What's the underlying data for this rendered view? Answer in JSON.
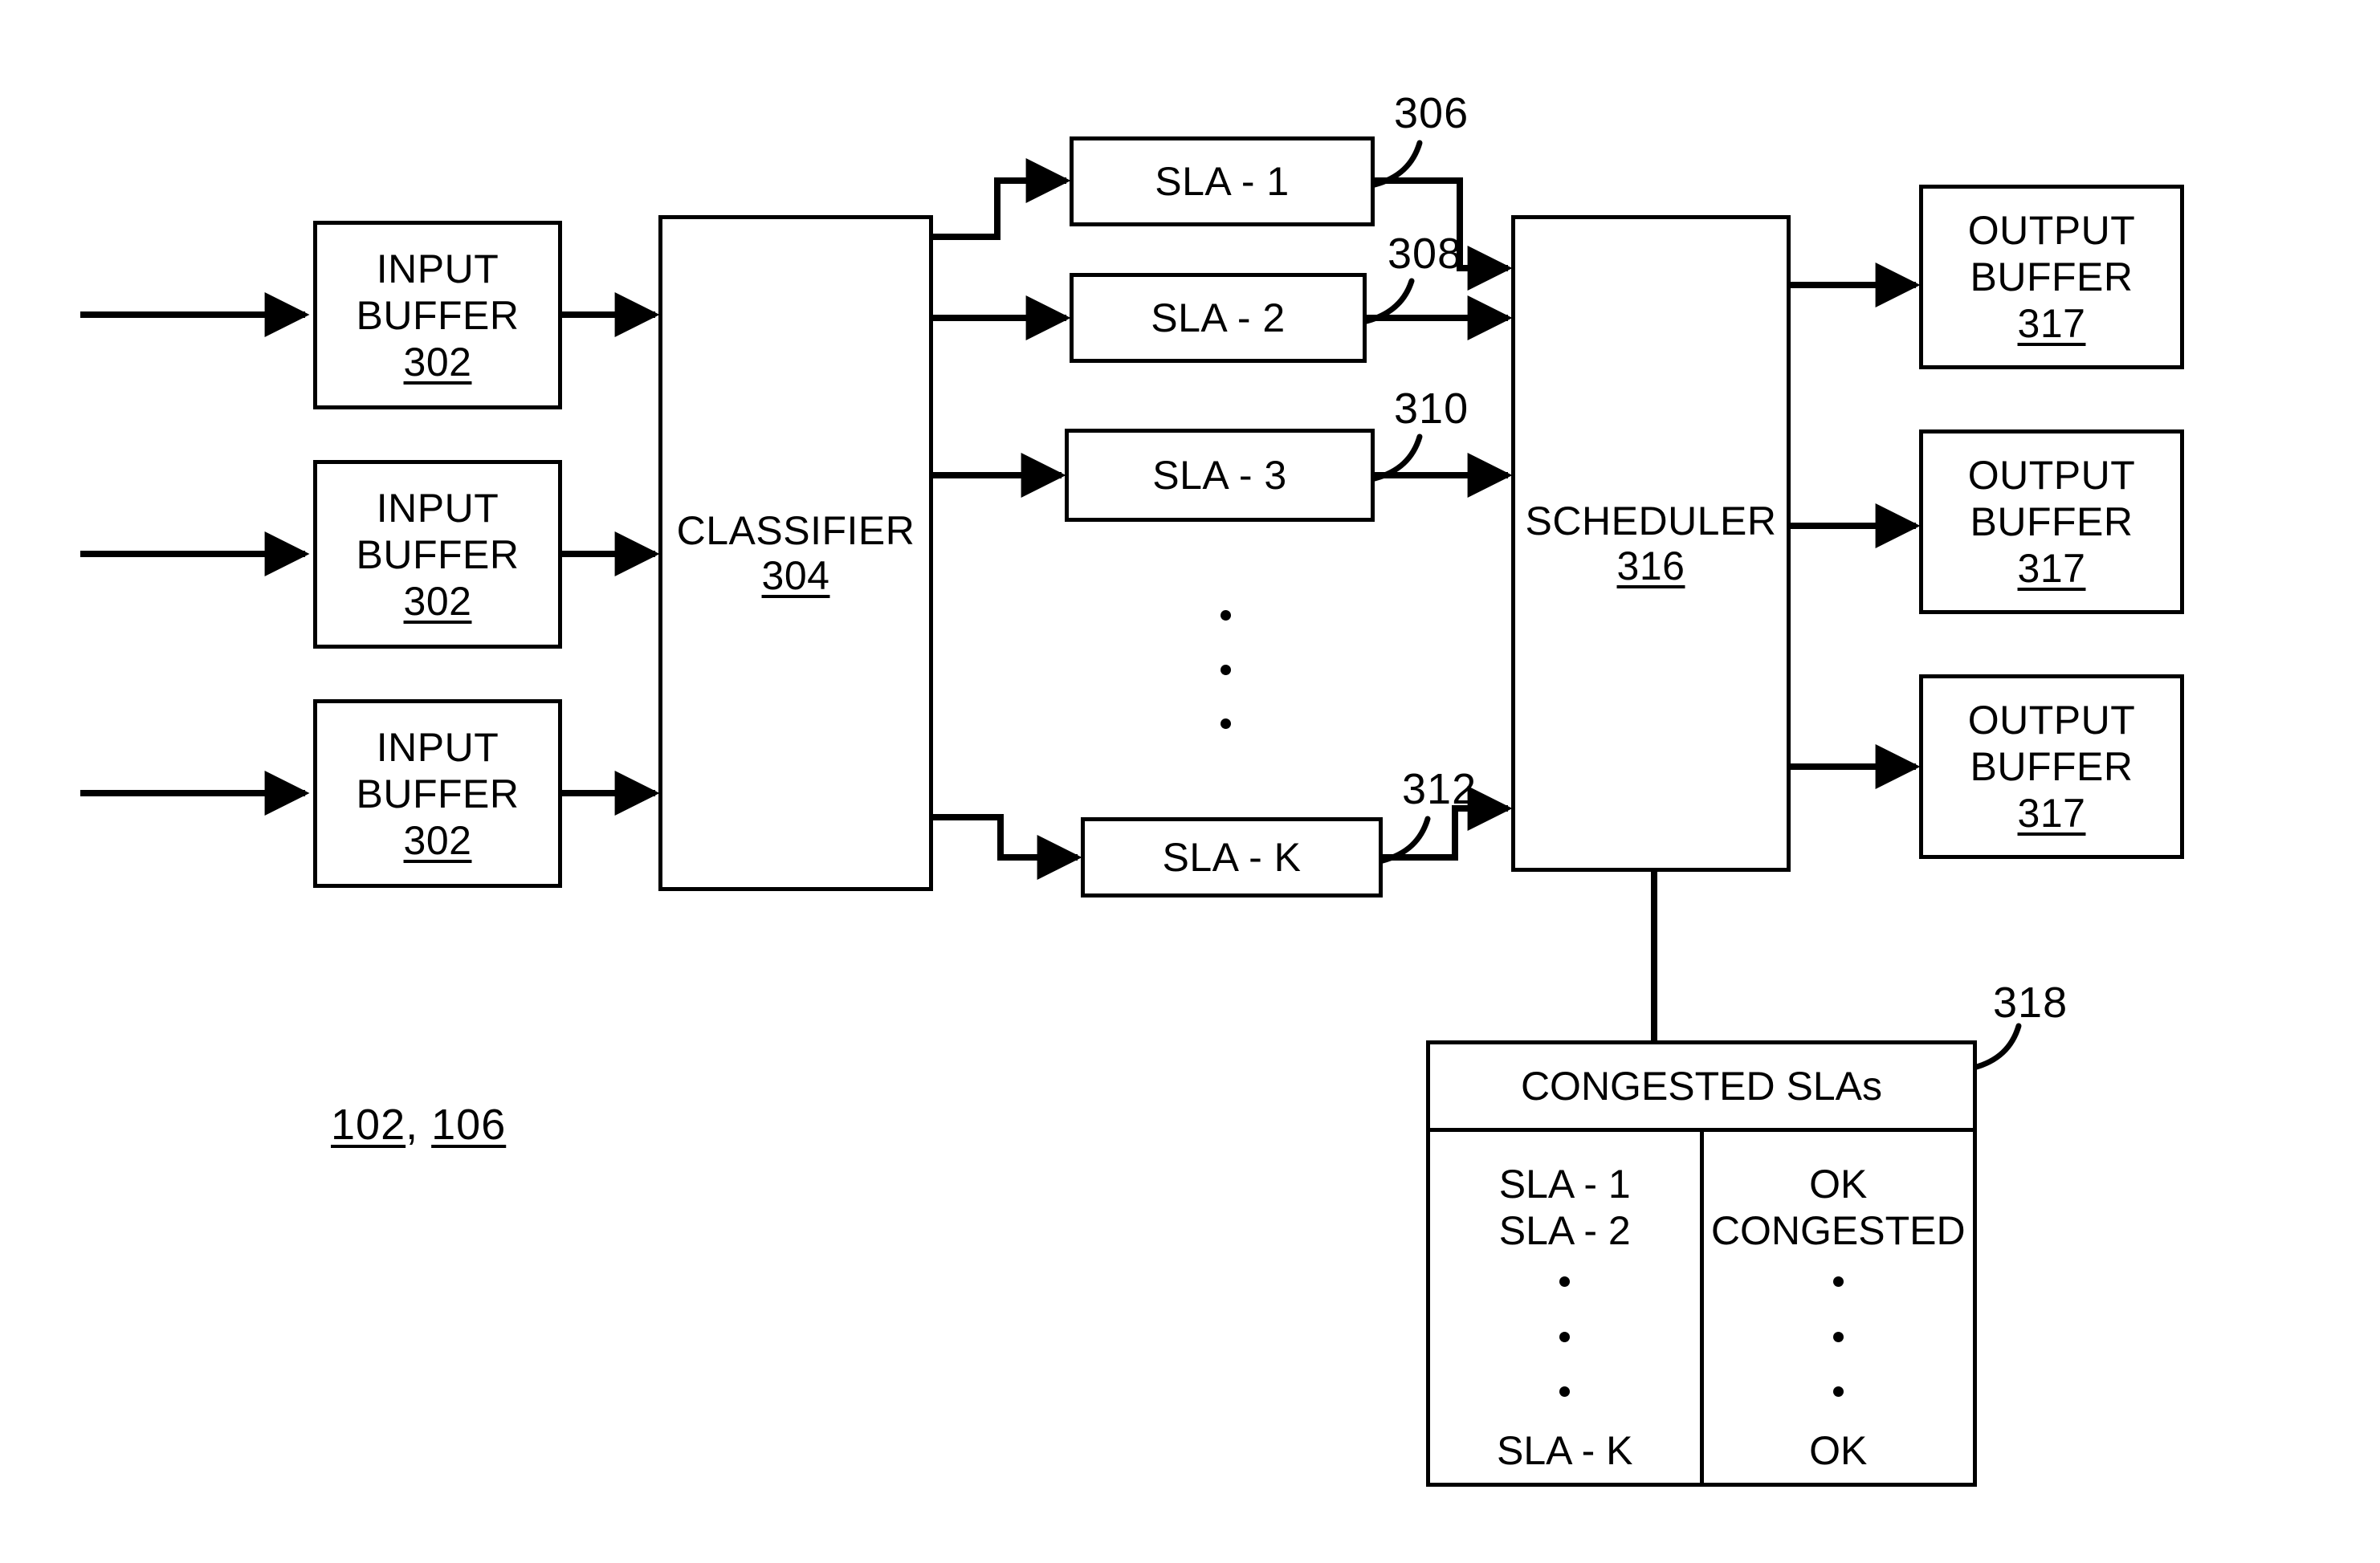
{
  "figure": {
    "system_tag_prefix": "102",
    "system_tag_sep": ", ",
    "system_tag_suffix": "106"
  },
  "input_buffers": [
    {
      "line1": "INPUT",
      "line2": "BUFFER",
      "ref": "302"
    },
    {
      "line1": "INPUT",
      "line2": "BUFFER",
      "ref": "302"
    },
    {
      "line1": "INPUT",
      "line2": "BUFFER",
      "ref": "302"
    }
  ],
  "classifier": {
    "label": "CLASSIFIER",
    "ref": "304"
  },
  "sla_queues": [
    {
      "label": "SLA - 1",
      "ref": "306"
    },
    {
      "label": "SLA - 2",
      "ref": "308"
    },
    {
      "label": "SLA - 3",
      "ref": "310"
    },
    {
      "label": "SLA - K",
      "ref": "312"
    }
  ],
  "scheduler": {
    "label": "SCHEDULER",
    "ref": "316"
  },
  "output_buffers": [
    {
      "line1": "OUTPUT",
      "line2": "BUFFER",
      "ref": "317"
    },
    {
      "line1": "OUTPUT",
      "line2": "BUFFER",
      "ref": "317"
    },
    {
      "line1": "OUTPUT",
      "line2": "BUFFER",
      "ref": "317"
    }
  ],
  "congested_table": {
    "ref": "318",
    "header": "CONGESTED SLAs",
    "rows": [
      {
        "sla": "SLA - 1",
        "status": "OK"
      },
      {
        "sla": "SLA - 2",
        "status": "CONGESTED"
      }
    ],
    "last_row": {
      "sla": "SLA - K",
      "status": "OK"
    }
  },
  "colors": {
    "ink": "#000000",
    "paper": "#ffffff"
  }
}
